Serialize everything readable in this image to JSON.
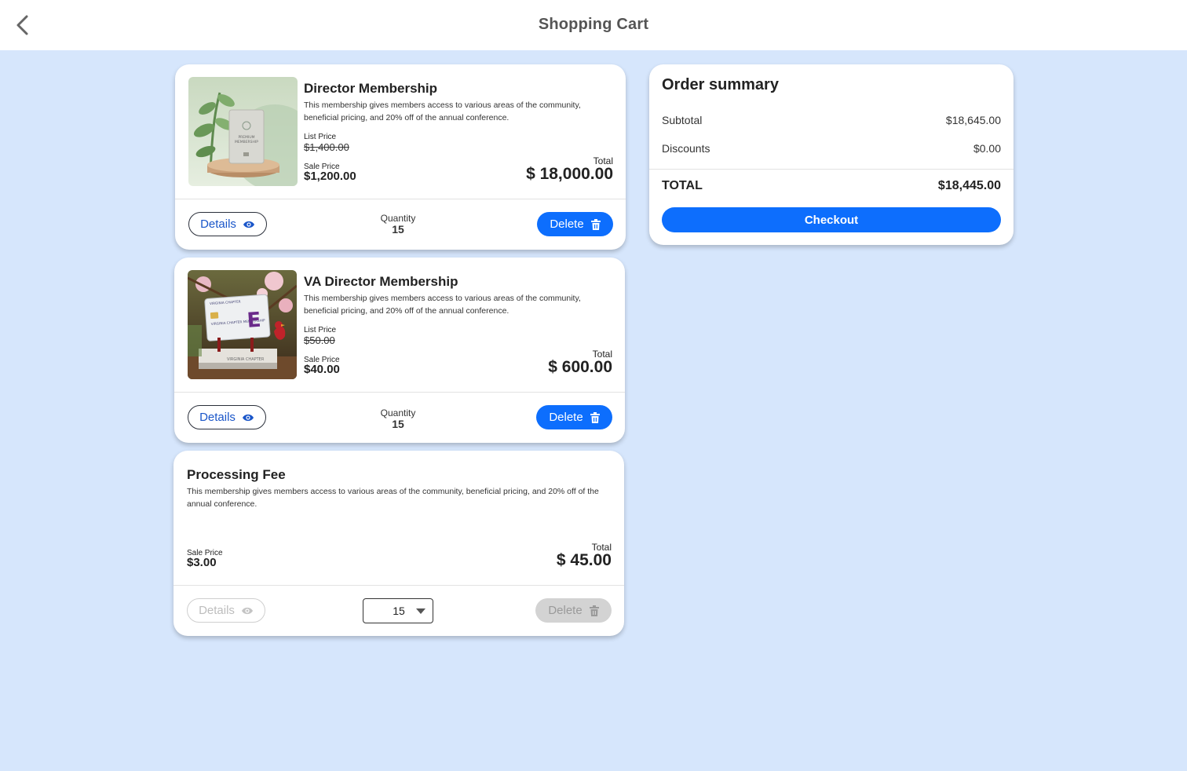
{
  "header": {
    "title": "Shopping Cart",
    "back_icon": "chevron-left-icon"
  },
  "cart": {
    "items": [
      {
        "title": "Director Membership",
        "description": "This membership gives members access to various areas of the community, beneficial pricing, and 20% off of the annual conference.",
        "list_price_label": "List Price",
        "list_price": "$1,400.00",
        "sale_price_label": "Sale Price",
        "sale_price": "$1,200.00",
        "total_label": "Total",
        "total": "$ 18,000.00",
        "details_label": "Details",
        "quantity_label": "Quantity",
        "quantity": "15",
        "delete_label": "Delete",
        "image_subject": "premium-membership-card-image"
      },
      {
        "title": "VA Director Membership",
        "description": "This membership gives members access to various areas of the community, beneficial pricing, and 20% off of the annual conference.",
        "list_price_label": "List Price",
        "list_price": "$50.00",
        "sale_price_label": "Sale Price",
        "sale_price": "$40.00",
        "total_label": "Total",
        "total": "$ 600.00",
        "details_label": "Details",
        "quantity_label": "Quantity",
        "quantity": "15",
        "delete_label": "Delete",
        "image_subject": "virginia-chapter-membership-card-image",
        "image_text": {
          "card_top": "VIRGINIA CHAPTER",
          "card_body": "VIRGINIA CHAPTER MEMBERSHIP",
          "card_letter": "E",
          "stand_label": "VIRGINIA CHAPTER"
        }
      },
      {
        "title": "Processing Fee",
        "description": "This membership gives members access to various areas of the community, beneficial pricing, and 20% off of the annual conference.",
        "sale_price_label": "Sale Price",
        "sale_price": "$3.00",
        "total_label": "Total",
        "total": "$ 45.00",
        "details_label": "Details",
        "quantity": "15",
        "delete_label": "Delete",
        "disabled_actions": true
      }
    ]
  },
  "summary": {
    "title": "Order summary",
    "subtotal_label": "Subtotal",
    "subtotal": "$18,645.00",
    "discounts_label": "Discounts",
    "discounts": "$0.00",
    "total_label": "TOTAL",
    "total": "$18,445.00",
    "checkout_label": "Checkout"
  },
  "colors": {
    "background": "#d6e6fc",
    "primary": "#0d6efd",
    "link": "#1a56c9",
    "disabled": "#d3d3d3"
  },
  "icons": {
    "details": "eye-icon",
    "delete": "trash-icon",
    "dropdown": "caret-down-icon"
  }
}
